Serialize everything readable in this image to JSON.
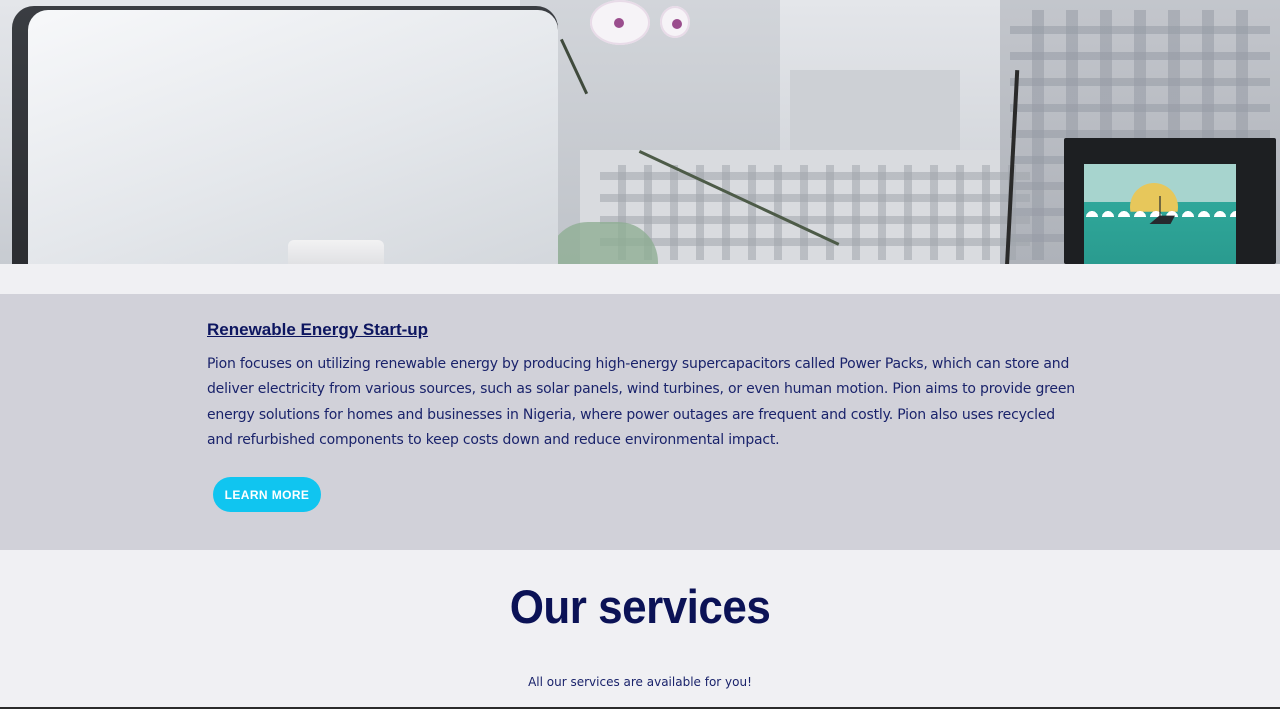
{
  "intro": {
    "title": "Renewable Energy Start-up",
    "text": " Pion focuses on utilizing renewable energy by producing high-energy supercapacitors called Power Packs, which can store and deliver electricity from various sources, such as solar panels, wind turbines, or even human motion. Pion aims to provide green energy solutions for homes and businesses in Nigeria, where power outages are frequent and costly. Pion also uses recycled and refurbished components to keep costs down and reduce environmental impact.",
    "button_label": "LEARN MORE"
  },
  "services": {
    "title": "Our services",
    "subtitle": "All our services are available for you!"
  },
  "colors": {
    "accent_button": "#10c5f0",
    "heading_navy": "#0b1256",
    "intro_band": "#d1d1d9",
    "page_bg": "#f0f0f3"
  }
}
